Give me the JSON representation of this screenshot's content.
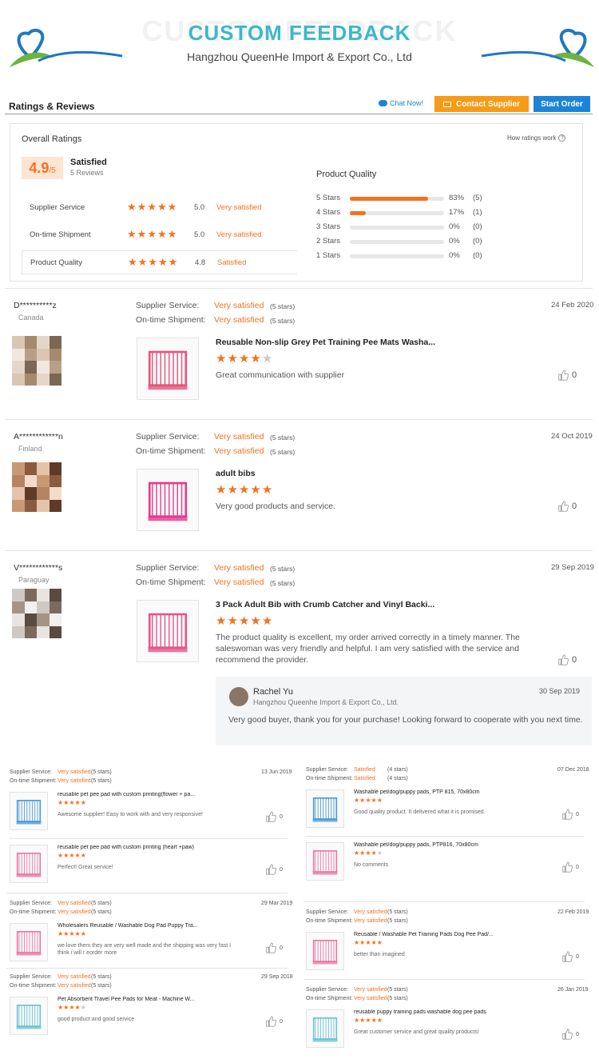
{
  "header": {
    "watermark": "CUSTOM FEEDBACK",
    "title": "CUSTOM FEEDBACK",
    "subtitle": "Hangzhou QueenHe Import & Export Co., Ltd"
  },
  "toolbar": {
    "section_title": "Ratings & Reviews",
    "chat_label": "Chat Now!",
    "contact_label": "Contact Supplier",
    "order_label": "Start Order"
  },
  "overall": {
    "title": "Overall Ratings",
    "how_link": "How ratings work",
    "score": "4.9",
    "score_suffix": "/5",
    "verdict": "Satisfied",
    "review_count": "5 Reviews",
    "rows": [
      {
        "label": "Supplier Service",
        "value": "5.0",
        "text": "Very satisfied"
      },
      {
        "label": "On-time Shipment",
        "value": "5.0",
        "text": "Very satisfied"
      },
      {
        "label": "Product Quality",
        "value": "4.8",
        "text": "Satisfied"
      }
    ],
    "pq_title": "Product Quality",
    "dist": [
      {
        "label": "5 Stars",
        "pct": "83%",
        "count": "(5)",
        "fill": 0.83
      },
      {
        "label": "4 Stars",
        "pct": "17%",
        "count": "(1)",
        "fill": 0.17
      },
      {
        "label": "3 Stars",
        "pct": "0%",
        "count": "(0)",
        "fill": 0
      },
      {
        "label": "2 Stars",
        "pct": "0%",
        "count": "(0)",
        "fill": 0
      },
      {
        "label": "1 Stars",
        "pct": "0%",
        "count": "(0)",
        "fill": 0
      }
    ]
  },
  "common": {
    "supplier_service": "Supplier Service:",
    "ontime_shipment": "On-time Shipment:",
    "five_stars": "(5 stars)",
    "four_stars": "(4 stars)"
  },
  "reviews": [
    {
      "name": "D**********z",
      "country": "Canada",
      "date": "24 Feb 2020",
      "service": "Very satisfied",
      "shipment": "Very satisfied",
      "product": "Reusable Non-slip Grey Pet Training Pee Mats Washa...",
      "stars": 4,
      "comment": "Great communication with supplier",
      "likes": "0"
    },
    {
      "name": "A************n",
      "country": "Finland",
      "date": "24 Oct 2019",
      "service": "Very satisfied",
      "shipment": "Very satisfied",
      "product": "adult bibs",
      "stars": 5,
      "comment": "Very good products and service.",
      "likes": "0"
    },
    {
      "name": "V************s",
      "country": "Paraguay",
      "date": "29 Sep 2019",
      "service": "Very satisfied",
      "shipment": "Very satisfied",
      "product": "3 Pack Adult Bib with Crumb Catcher and Vinyl Backi...",
      "stars": 5,
      "comment": "The product quality is excellent, my order arrived correctly in a timely manner. The saleswoman was very friendly and helpful. I am very satisfied with the service and recommend the provider.",
      "likes": "0"
    }
  ],
  "reply": {
    "name": "Rachel Yu",
    "company": "Hangzhou Queenhe Import & Export Co., Ltd.",
    "date": "30 Sep 2019",
    "text": "Very good buyer, thank you for your purchase! Looking forward to cooperate with you next time."
  },
  "mini_left": [
    {
      "date": "13 Jun 2019",
      "service": "Very satisfied",
      "shipment": "Very satisfied",
      "items": [
        {
          "product": "reusable pet pee pad with custom printing(flower + pa...",
          "stars": 5,
          "comment": "Awesome supplier! Easy to work with and very responsive!",
          "likes": "0"
        },
        {
          "product": "reusable pet pee pad with custom printing (heart +paw)",
          "stars": 5,
          "comment": "Perfect! Great service!",
          "likes": "0"
        }
      ]
    },
    {
      "date": "29 Mar 2019",
      "service": "Very satisfied",
      "shipment": "Very satisfied",
      "items": [
        {
          "product": "Wholesalers Reusable / Washable Dog Pad Puppy Tra...",
          "stars": 5,
          "comment": "we love them they are very well made and the shipping was very fast I think i will r eorder more",
          "likes": "0"
        }
      ]
    },
    {
      "date": "29 Sep 2018",
      "service": "Very satisfied",
      "shipment": "Very satisfied",
      "items": [
        {
          "product": "Pet Absorbent Travel Pee Pads for Meat - Machine W...",
          "stars": 4,
          "comment": "good product and good service",
          "likes": "0"
        }
      ]
    }
  ],
  "mini_right": [
    {
      "date": "07 Dec 2018",
      "service": "Satisfied",
      "shipment": "Satisfied",
      "stars_note": "(4 stars)",
      "items": [
        {
          "product": "Washable pet/dog/puppy pads, PTP 815, 70x80cm",
          "stars": 5,
          "comment": "Good quality product. It delivered what it is promised.",
          "likes": "0"
        },
        {
          "product": "Washable pet/dog/puppy pads, PTP816, 70x80cm",
          "stars": 4,
          "comment": "No comments",
          "likes": "0"
        }
      ]
    },
    {
      "date": "22 Feb 2019",
      "service": "Very satisfied",
      "shipment": "Very satisfied",
      "stars_note": "(5 stars)",
      "items": [
        {
          "product": "Reusable / Washable Pet Training Pads Dog Pee Pad/...",
          "stars": 5,
          "comment": "better than imagined",
          "likes": "0"
        }
      ]
    },
    {
      "date": "26 Jan 2019",
      "service": "Very satisfied",
      "shipment": "Very satisfied",
      "stars_note": "(5 stars)",
      "items": [
        {
          "product": "reusable puppy training pads washable dog pee pads",
          "stars": 5,
          "comment": "Great customer service and great quality products!",
          "likes": "0"
        }
      ]
    }
  ],
  "colors": {
    "accent": "#f4711f",
    "title_teal": "#3cb8c8",
    "button_blue": "#1c84d6",
    "button_orange": "#f79a17",
    "leaf_green": "#6db33f",
    "heart_blue": "#1f78c1"
  }
}
